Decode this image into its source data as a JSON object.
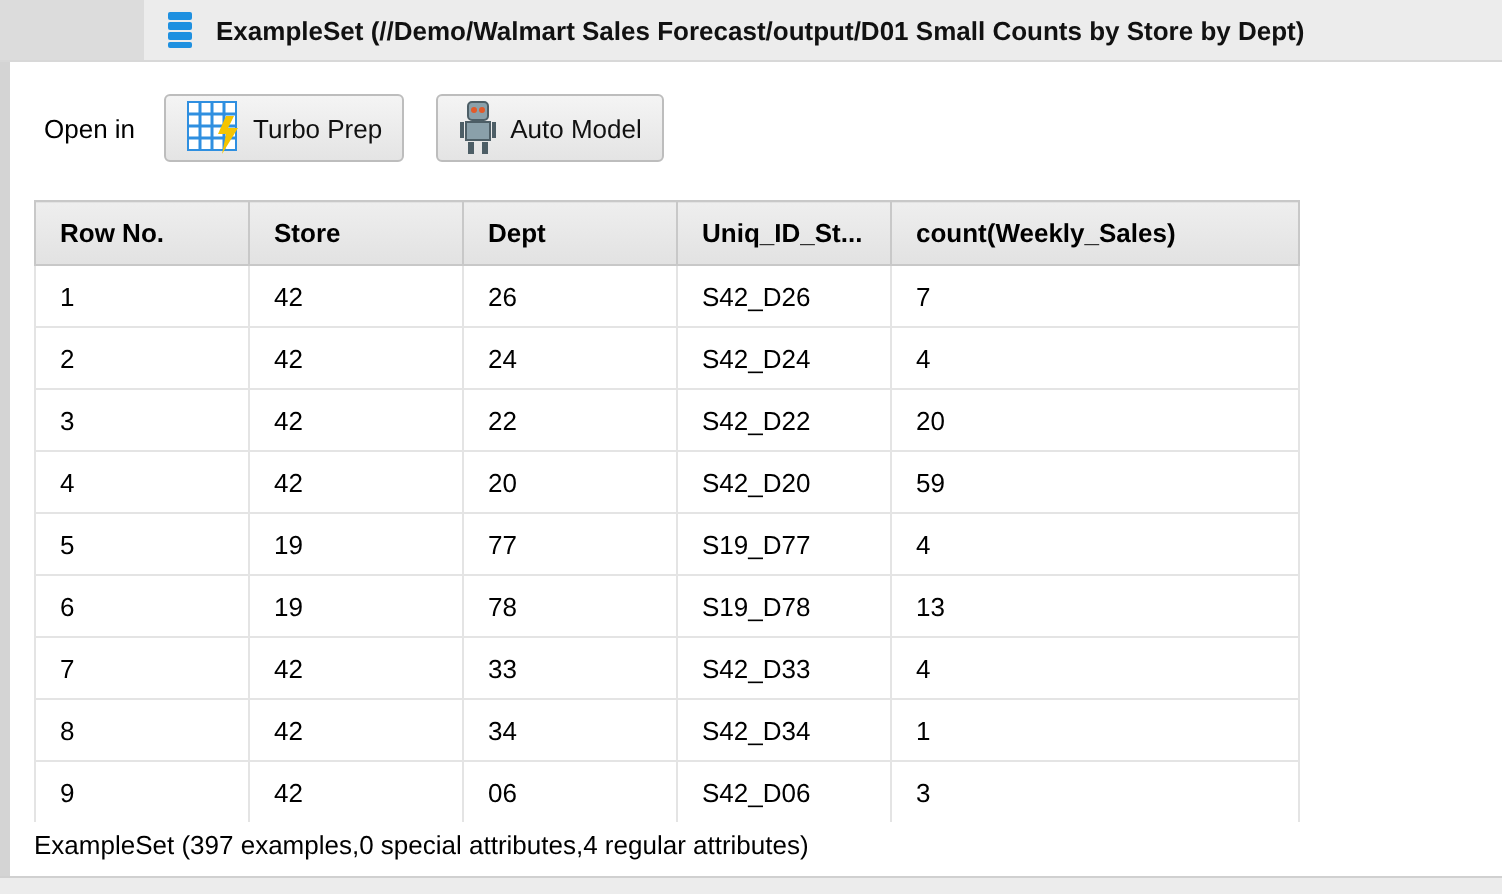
{
  "tab": {
    "title": "ExampleSet (//Demo/Walmart Sales Forecast/output/D01 Small Counts by Store by Dept)"
  },
  "toolbar": {
    "label": "Open in",
    "buttons": [
      {
        "label": "Turbo Prep",
        "kind": "grid"
      },
      {
        "label": "Auto Model",
        "kind": "robot"
      }
    ]
  },
  "table": {
    "columns": [
      "Row No.",
      "Store",
      "Dept",
      "Uniq_ID_St...",
      "count(Weekly_Sales)"
    ],
    "rows": [
      [
        "1",
        "42",
        "26",
        "S42_D26",
        "7"
      ],
      [
        "2",
        "42",
        "24",
        "S42_D24",
        "4"
      ],
      [
        "3",
        "42",
        "22",
        "S42_D22",
        "20"
      ],
      [
        "4",
        "42",
        "20",
        "S42_D20",
        "59"
      ],
      [
        "5",
        "19",
        "77",
        "S19_D77",
        "4"
      ],
      [
        "6",
        "19",
        "78",
        "S19_D78",
        "13"
      ],
      [
        "7",
        "42",
        "33",
        "S42_D33",
        "4"
      ],
      [
        "8",
        "42",
        "34",
        "S42_D34",
        "1"
      ],
      [
        "9",
        "42",
        "06",
        "S42_D06",
        "3"
      ]
    ]
  },
  "status_bar": "ExampleSet (397 examples,0 special attributes,4 regular attributes)"
}
